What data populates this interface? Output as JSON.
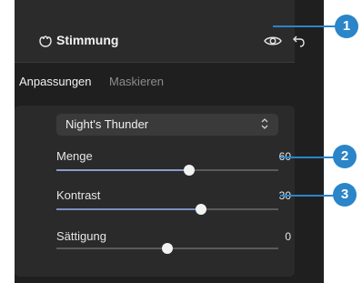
{
  "header": {
    "title": "Stimmung",
    "icons": [
      "mood-icon",
      "eye-icon",
      "undo-icon"
    ]
  },
  "tabs": [
    {
      "label": "Anpassungen",
      "active": true
    },
    {
      "label": "Maskieren",
      "active": false
    }
  ],
  "preset": {
    "value": "Night's Thunder"
  },
  "sliders": [
    {
      "label": "Menge",
      "value": "60",
      "level": 0.6,
      "fill_color": "#8a9bc7"
    },
    {
      "label": "Kontrast",
      "value": "30",
      "level": 0.65,
      "fill_color": "#7b8fc0"
    },
    {
      "label": "Sättigung",
      "value": "0",
      "level": 0.5,
      "fill_color": "#5a5a5a"
    }
  ],
  "callouts": [
    "1",
    "2",
    "3"
  ],
  "colors": {
    "accent": "#2a85c9",
    "panel": "#1f1f1f",
    "header": "#2b2b2b"
  }
}
